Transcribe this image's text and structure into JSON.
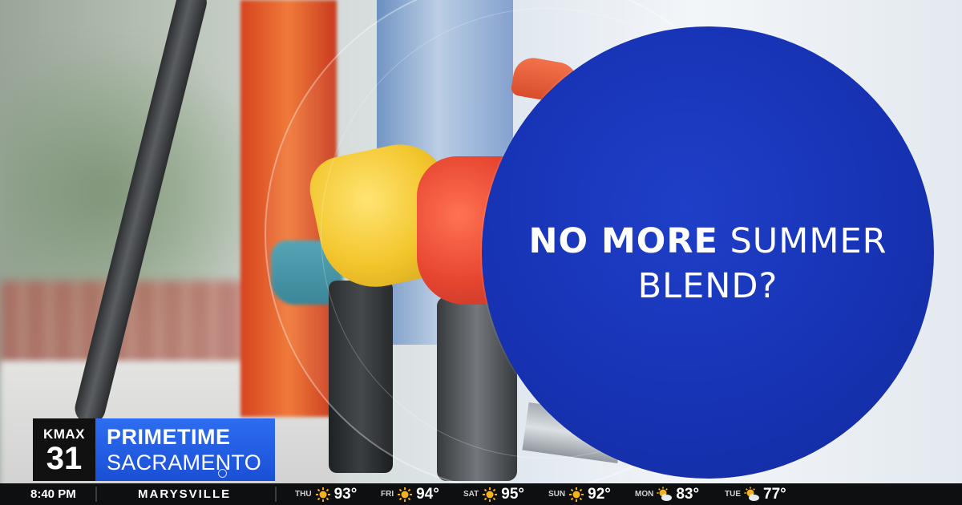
{
  "headline": {
    "line1_bold": "NO MORE",
    "line1_light": "SUMMER",
    "line2": "BLEND?"
  },
  "station": {
    "call": "KMAX",
    "channel": "31"
  },
  "show": {
    "line1": "PRIMETIME",
    "line2": "SACRAMENTO"
  },
  "ticker": {
    "time": "8:40 PM",
    "city": "MARYSVILLE",
    "forecast": [
      {
        "day": "THU",
        "temp": "93°",
        "icon": "sun-icon"
      },
      {
        "day": "FRI",
        "temp": "94°",
        "icon": "sun-icon"
      },
      {
        "day": "SAT",
        "temp": "95°",
        "icon": "sun-icon"
      },
      {
        "day": "SUN",
        "temp": "92°",
        "icon": "sun-icon"
      },
      {
        "day": "MON",
        "temp": "83°",
        "icon": "partly-cloudy-icon"
      },
      {
        "day": "TUE",
        "temp": "77°",
        "icon": "partly-cloudy-icon"
      }
    ]
  },
  "colors": {
    "brand_blue": "#1733b4",
    "show_blue": "#1a4fd6",
    "sun": "#f5b21b",
    "ticker_bg": "#0e0f10"
  }
}
